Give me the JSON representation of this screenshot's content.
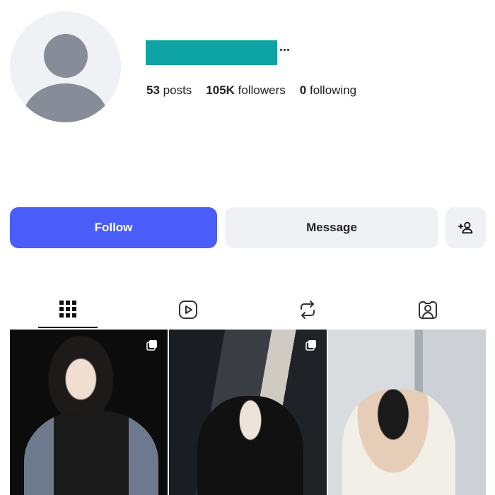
{
  "profile": {
    "username_redacted_color": "#0ea3a4",
    "stats": {
      "posts_count": "53",
      "posts_label": "posts",
      "followers_count": "105K",
      "followers_label": "followers",
      "following_count": "0",
      "following_label": "following"
    }
  },
  "actions": {
    "follow_label": "Follow",
    "message_label": "Message",
    "add_user_icon": "add-user-icon"
  },
  "tabs": [
    {
      "name": "posts",
      "icon": "grid-icon",
      "active": true
    },
    {
      "name": "reels",
      "icon": "reels-icon",
      "active": false
    },
    {
      "name": "reposts",
      "icon": "repost-icon",
      "active": false
    },
    {
      "name": "tagged",
      "icon": "tagged-icon",
      "active": false
    }
  ],
  "posts": [
    {
      "multi_image": true
    },
    {
      "multi_image": true
    },
    {
      "multi_image": false
    }
  ],
  "colors": {
    "accent": "#4a5df9",
    "secondary_button": "#eff1f5",
    "avatar_placeholder": "#878c98"
  }
}
